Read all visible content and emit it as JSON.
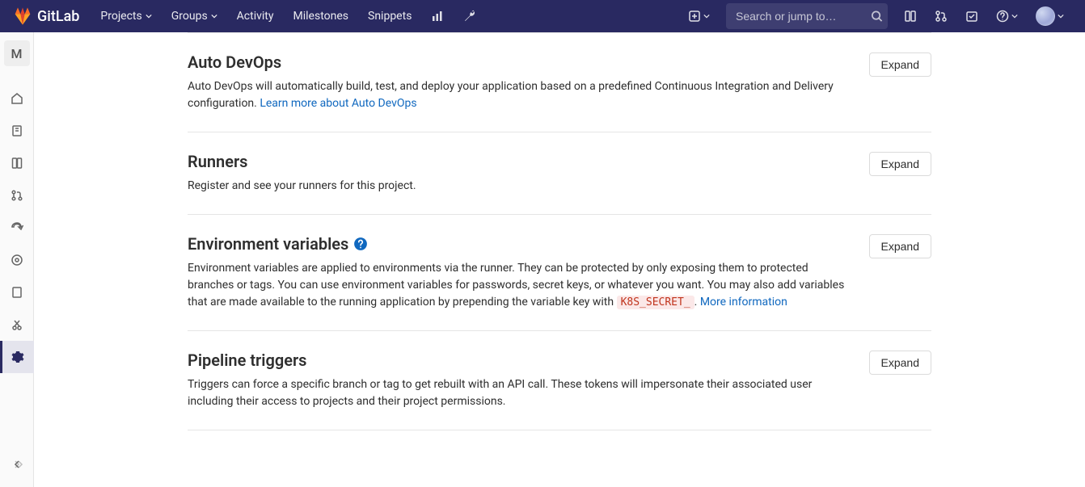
{
  "brand": {
    "name": "GitLab"
  },
  "nav": {
    "projects": "Projects",
    "groups": "Groups",
    "activity": "Activity",
    "milestones": "Milestones",
    "snippets": "Snippets"
  },
  "search": {
    "placeholder": "Search or jump to…"
  },
  "sidebar": {
    "project_letter": "M"
  },
  "sections": {
    "auto_devops": {
      "title": "Auto DevOps",
      "desc_pre": "Auto DevOps will automatically build, test, and deploy your application based on a predefined Continuous Integration and Delivery configuration. ",
      "link": "Learn more about Auto DevOps",
      "expand": "Expand"
    },
    "runners": {
      "title": "Runners",
      "desc": "Register and see your runners for this project.",
      "expand": "Expand"
    },
    "env_vars": {
      "title": "Environment variables",
      "desc_pre": "Environment variables are applied to environments via the runner. They can be protected by only exposing them to protected branches or tags. You can use environment variables for passwords, secret keys, or whatever you want. You may also add variables that are made available to the running application by prepending the variable key with ",
      "code": "K8S_SECRET_",
      "desc_post": ". ",
      "link": "More information",
      "expand": "Expand"
    },
    "triggers": {
      "title": "Pipeline triggers",
      "desc": "Triggers can force a specific branch or tag to get rebuilt with an API call. These tokens will impersonate their associated user including their access to projects and their project permissions.",
      "expand": "Expand"
    }
  }
}
